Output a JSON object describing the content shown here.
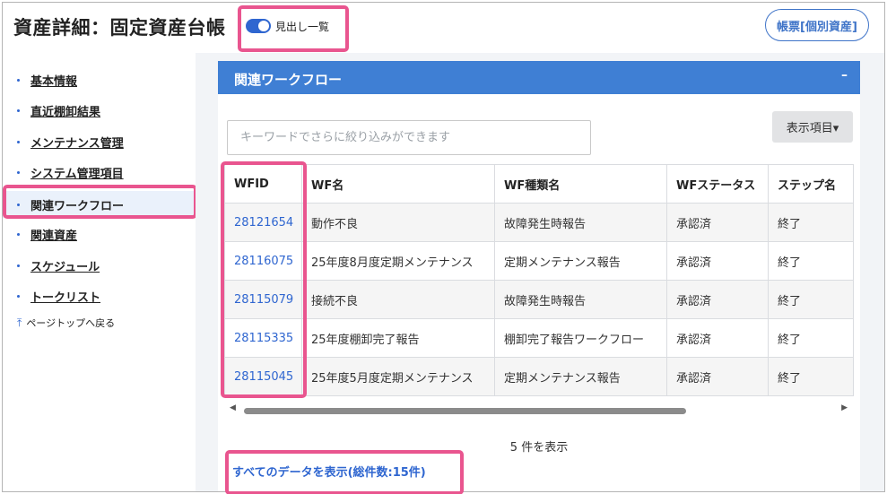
{
  "header": {
    "title": "資産詳細：固定資産台帳",
    "toggle_label": "見出し一覧",
    "toggle_on": true,
    "ledger_button": "帳票[個別資産]"
  },
  "sidebar": {
    "items": [
      {
        "label": "基本情報"
      },
      {
        "label": "直近棚卸結果"
      },
      {
        "label": "メンテナンス管理"
      },
      {
        "label": "システム管理項目"
      },
      {
        "label": "関連ワークフロー",
        "active": true
      },
      {
        "label": "関連資産"
      },
      {
        "label": "スケジュール"
      },
      {
        "label": "トークリスト"
      }
    ],
    "back_to_top": "ページトップへ戻る"
  },
  "panel": {
    "title": "関連ワークフロー",
    "collapse_symbol": "–",
    "search_placeholder": "キーワードでさらに絞り込みができます",
    "columns_button": "表示項目▾",
    "table": {
      "headers": [
        "WFID",
        "WF名",
        "WF種類名",
        "WFステータス",
        "ステップ名"
      ],
      "rows": [
        [
          "28121654",
          "動作不良",
          "故障発生時報告",
          "承認済",
          "終了"
        ],
        [
          "28116075",
          "25年度8月度定期メンテナンス",
          "定期メンテナンス報告",
          "承認済",
          "終了"
        ],
        [
          "28115079",
          "接続不良",
          "故障発生時報告",
          "承認済",
          "終了"
        ],
        [
          "28115335",
          "25年度棚卸完了報告",
          "棚卸完了報告ワークフロー",
          "承認済",
          "終了"
        ],
        [
          "28115045",
          "25年度5月度定期メンテナンス",
          "定期メンテナンス報告",
          "承認済",
          "終了"
        ]
      ]
    },
    "count_text": "5 件を表示",
    "show_all_link": "すべてのデータを表示(総件数:15件)"
  },
  "colors": {
    "accent": "#3f7fd4",
    "link": "#2f66d0",
    "highlight": "#e9558f"
  },
  "icons": {
    "scroll_left": "left-arrow-icon",
    "scroll_right": "right-arrow-icon",
    "back_to_top": "arrow-up-bar-icon"
  }
}
